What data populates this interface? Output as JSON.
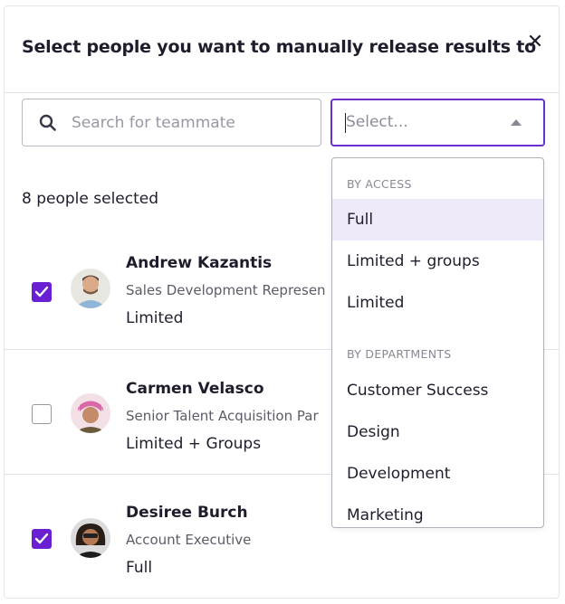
{
  "modal": {
    "title": "Select people you want to manually release results to",
    "close_glyph": "✕"
  },
  "search": {
    "placeholder": "Search for teammate",
    "value": ""
  },
  "select": {
    "placeholder": "Select..."
  },
  "selected_count": "8 people selected",
  "people": [
    {
      "name": "Andrew Kazantis",
      "role": "Sales Development Represen",
      "access": "Limited",
      "checked": true
    },
    {
      "name": "Carmen Velasco",
      "role": "Senior Talent Acquisition Par",
      "access": "Limited + Groups",
      "checked": false
    },
    {
      "name": "Desiree Burch",
      "role": "Account Executive",
      "access": "Full",
      "checked": true
    }
  ],
  "dropdown": {
    "groups": [
      {
        "label": "BY ACCESS",
        "items": [
          "Full",
          "Limited + groups",
          "Limited"
        ]
      },
      {
        "label": "BY DEPARTMENTS",
        "items": [
          "Customer Success",
          "Design",
          "Development",
          "Marketing"
        ]
      }
    ],
    "highlighted": "Full"
  },
  "colors": {
    "accent": "#6a1fd3",
    "highlight": "#efeafa"
  },
  "icons": [
    "search-icon",
    "close-icon",
    "caret-up-icon",
    "checkmark-icon"
  ]
}
